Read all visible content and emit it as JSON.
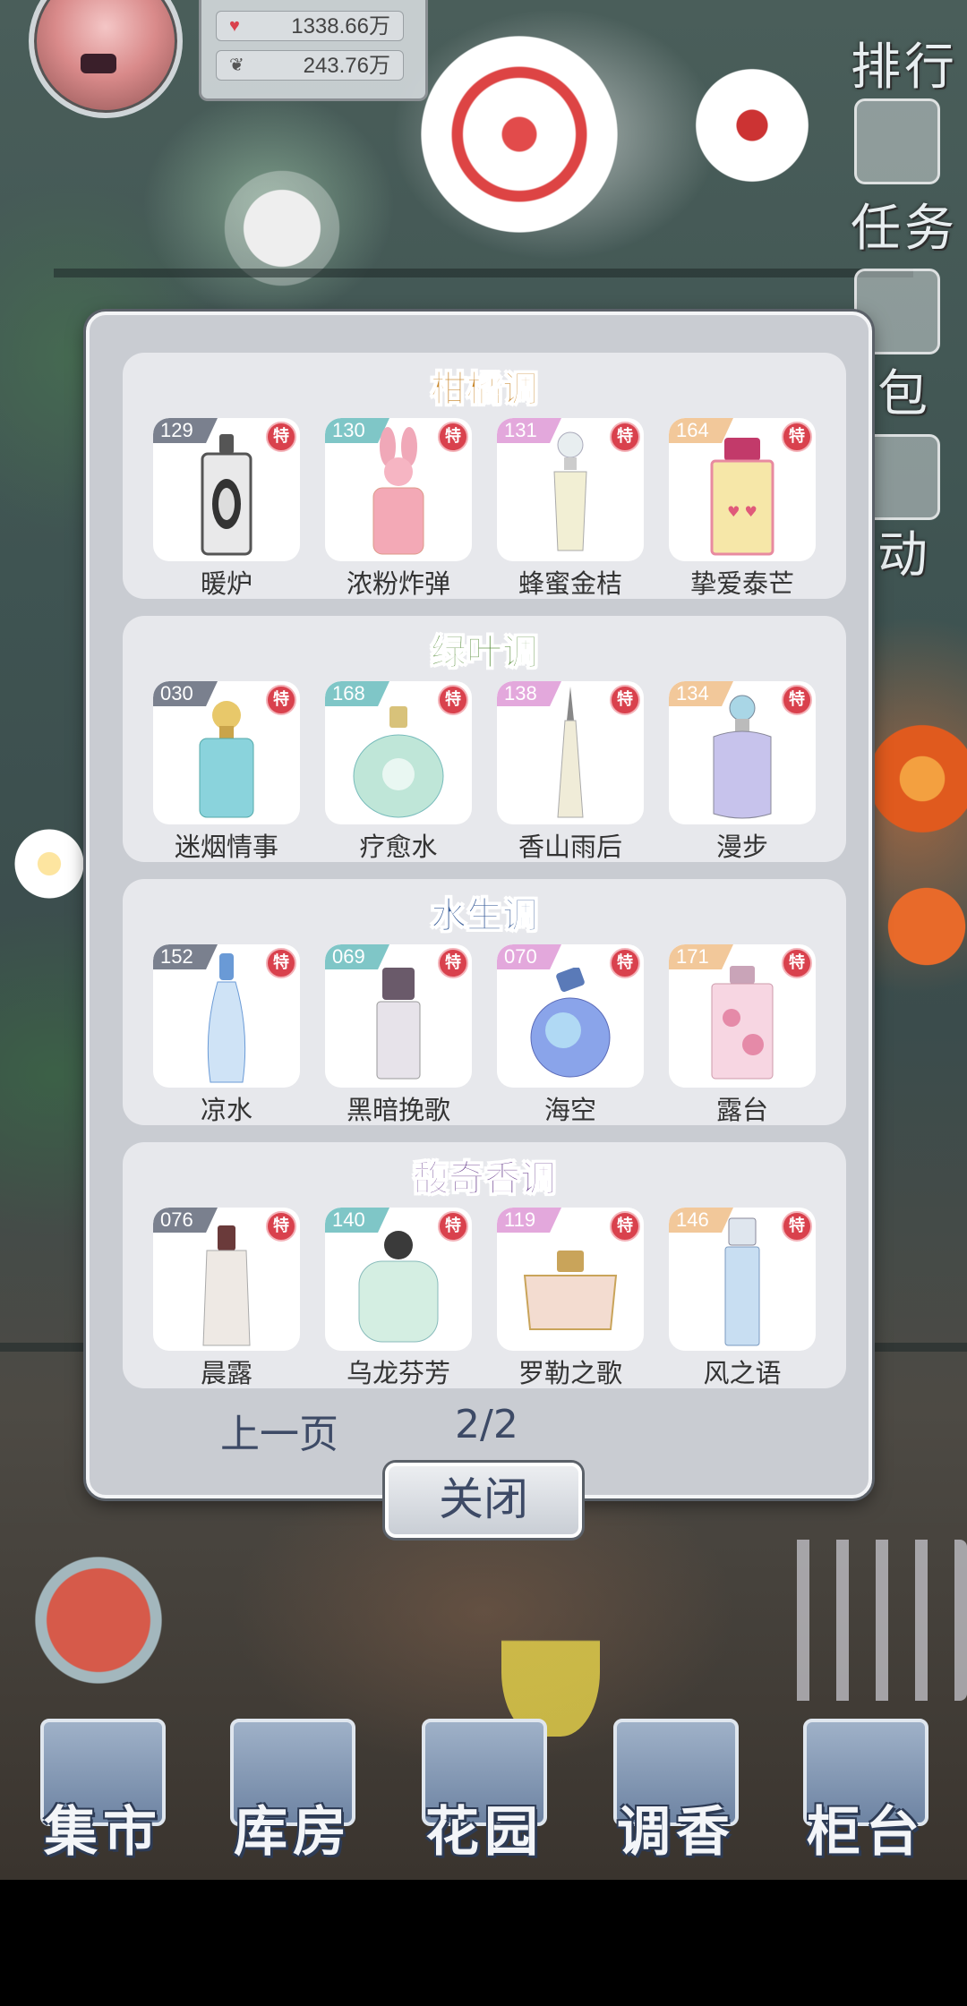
{
  "profile": {
    "stat1": "1338.66万",
    "stat2": "243.76万"
  },
  "side_menu": [
    "排行",
    "任务",
    "包",
    "动"
  ],
  "categories": [
    {
      "title": "柑橘调",
      "title_color": "#c9892f",
      "items": [
        {
          "num": "129",
          "badge_color": "#7a808e",
          "name": "暖炉",
          "special": "特"
        },
        {
          "num": "130",
          "badge_color": "#7fc6c7",
          "name": "浓粉炸弹",
          "special": "特"
        },
        {
          "num": "131",
          "badge_color": "#e3a8dc",
          "name": "蜂蜜金桔",
          "special": "特"
        },
        {
          "num": "164",
          "badge_color": "#f2c89a",
          "name": "挚爱泰芒",
          "special": "特"
        }
      ]
    },
    {
      "title": "绿叶调",
      "title_color": "#5a8f3e",
      "items": [
        {
          "num": "030",
          "badge_color": "#7a808e",
          "name": "迷烟情事",
          "special": "特"
        },
        {
          "num": "168",
          "badge_color": "#7fc6c7",
          "name": "疗愈水",
          "special": "特"
        },
        {
          "num": "138",
          "badge_color": "#e3a8dc",
          "name": "香山雨后",
          "special": "特"
        },
        {
          "num": "134",
          "badge_color": "#f2c89a",
          "name": "漫步",
          "special": "特"
        }
      ]
    },
    {
      "title": "水生调",
      "title_color": "#3b5f9a",
      "items": [
        {
          "num": "152",
          "badge_color": "#7a808e",
          "name": "凉水",
          "special": "特"
        },
        {
          "num": "069",
          "badge_color": "#7fc6c7",
          "name": "黑暗挽歌",
          "special": "特"
        },
        {
          "num": "070",
          "badge_color": "#e3a8dc",
          "name": "海空",
          "special": "特"
        },
        {
          "num": "171",
          "badge_color": "#f2c89a",
          "name": "露台",
          "special": "特"
        }
      ]
    },
    {
      "title": "馥奇香调",
      "title_color": "#6a3f8e",
      "items": [
        {
          "num": "076",
          "badge_color": "#7a808e",
          "name": "晨露",
          "special": "特"
        },
        {
          "num": "140",
          "badge_color": "#7fc6c7",
          "name": "乌龙芬芳",
          "special": "特"
        },
        {
          "num": "119",
          "badge_color": "#e3a8dc",
          "name": "罗勒之歌",
          "special": "特"
        },
        {
          "num": "146",
          "badge_color": "#f2c89a",
          "name": "风之语",
          "special": "特"
        }
      ]
    }
  ],
  "pager": {
    "prev_label": "上一页",
    "page": "2/2"
  },
  "close_label": "关闭",
  "bottom_nav": [
    "集市",
    "库房",
    "花园",
    "调香",
    "柜台"
  ]
}
